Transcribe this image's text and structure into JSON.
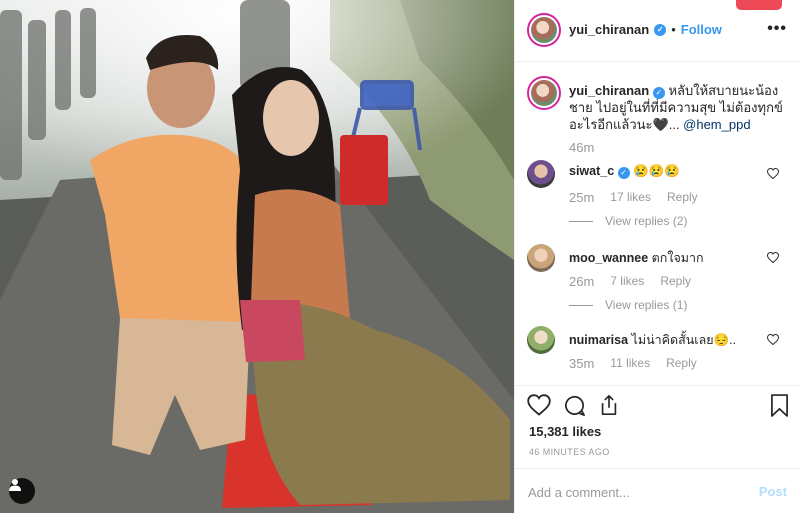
{
  "post": {
    "username": "yui_chiranan",
    "follow_label": "Follow",
    "separator": "•",
    "more_label": "•••",
    "caption_text": "หลับให้สบายนะน้องชาย ไปอยู่ในที่ที่มีความสุข ไม่ต้องทุกข์อะไรอีกแล้วนะ🖤... ",
    "caption_mention": "@hem_ppd",
    "caption_time": "46m",
    "likes": "15,381 likes",
    "time_ago": "46 MINUTES AGO",
    "comment_placeholder": "Add a comment...",
    "post_label": "Post"
  },
  "comments": [
    {
      "user": "siwat_c",
      "text": "😢😢😢",
      "time": "25m",
      "likes": "17 likes",
      "reply": "Reply",
      "view_replies": "View replies (2)"
    },
    {
      "user": "moo_wannee",
      "text": "ตกใจมาก",
      "time": "26m",
      "likes": "7 likes",
      "reply": "Reply",
      "view_replies": "View replies (1)"
    },
    {
      "user": "nuimarisa",
      "text": "ไม่น่าคิดสั้นเลย😔..",
      "time": "35m",
      "likes": "11 likes",
      "reply": "Reply",
      "view_replies": ""
    }
  ],
  "icons": {
    "verified": "verified-badge-icon",
    "heart": "heart-icon",
    "comment": "comment-bubble-icon",
    "share": "share-icon",
    "bookmark": "bookmark-icon",
    "user_tag": "user-tag-icon"
  },
  "colors": {
    "link_blue": "#3897f0",
    "avatar_ring": "#d6249f",
    "post_disabled": "#b2dffc",
    "muted": "#999999"
  }
}
